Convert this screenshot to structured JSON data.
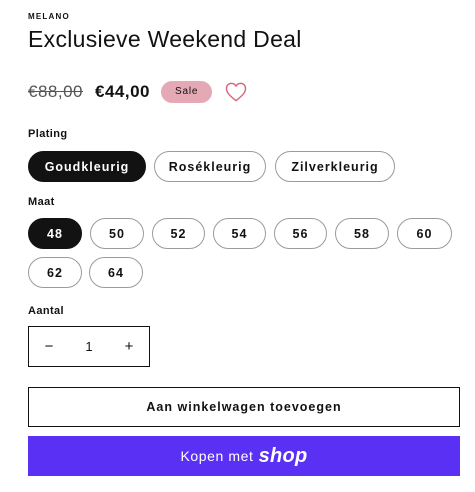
{
  "product": {
    "vendor": "MELANO",
    "title": "Exclusieve Weekend Deal",
    "price_old": "€88,00",
    "price_new": "€44,00",
    "sale_badge": "Sale",
    "wishlist_icon": "heart-outline-icon"
  },
  "options": {
    "plating": {
      "label": "Plating",
      "values": [
        "Goudkleurig",
        "Rosékleurig",
        "Zilverkleurig"
      ],
      "selected": "Goudkleurig"
    },
    "size": {
      "label": "Maat",
      "values": [
        "48",
        "50",
        "52",
        "54",
        "56",
        "58",
        "60",
        "62",
        "64"
      ],
      "selected": "48"
    }
  },
  "quantity": {
    "label": "Aantal",
    "value": "1",
    "minus": "−",
    "plus": "+"
  },
  "actions": {
    "add_to_cart": "Aan winkelwagen toevoegen",
    "buy_with": "Kopen met",
    "shop_logo": "shop"
  },
  "colors": {
    "selected_pill": "#121212",
    "sale_badge": "#e5a8b5",
    "heart": "#d9687f",
    "shop_pay": "#5a31f4"
  }
}
